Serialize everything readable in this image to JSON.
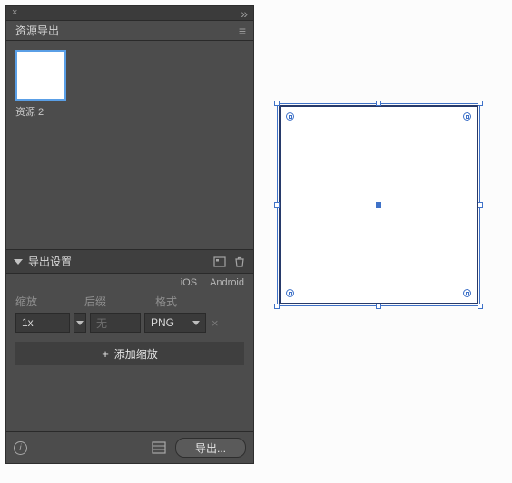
{
  "panel": {
    "title": "资源导出",
    "asset": {
      "name": "资源 2"
    },
    "exportSettings": {
      "label": "导出设置",
      "platforms": {
        "ios": "iOS",
        "android": "Android"
      },
      "columns": {
        "scale": "缩放",
        "suffix": "后缀",
        "format": "格式"
      },
      "row": {
        "scale": "1x",
        "suffixPlaceholder": "无",
        "format": "PNG"
      },
      "addScale": "添加缩放"
    },
    "footer": {
      "exportButton": "导出..."
    }
  }
}
